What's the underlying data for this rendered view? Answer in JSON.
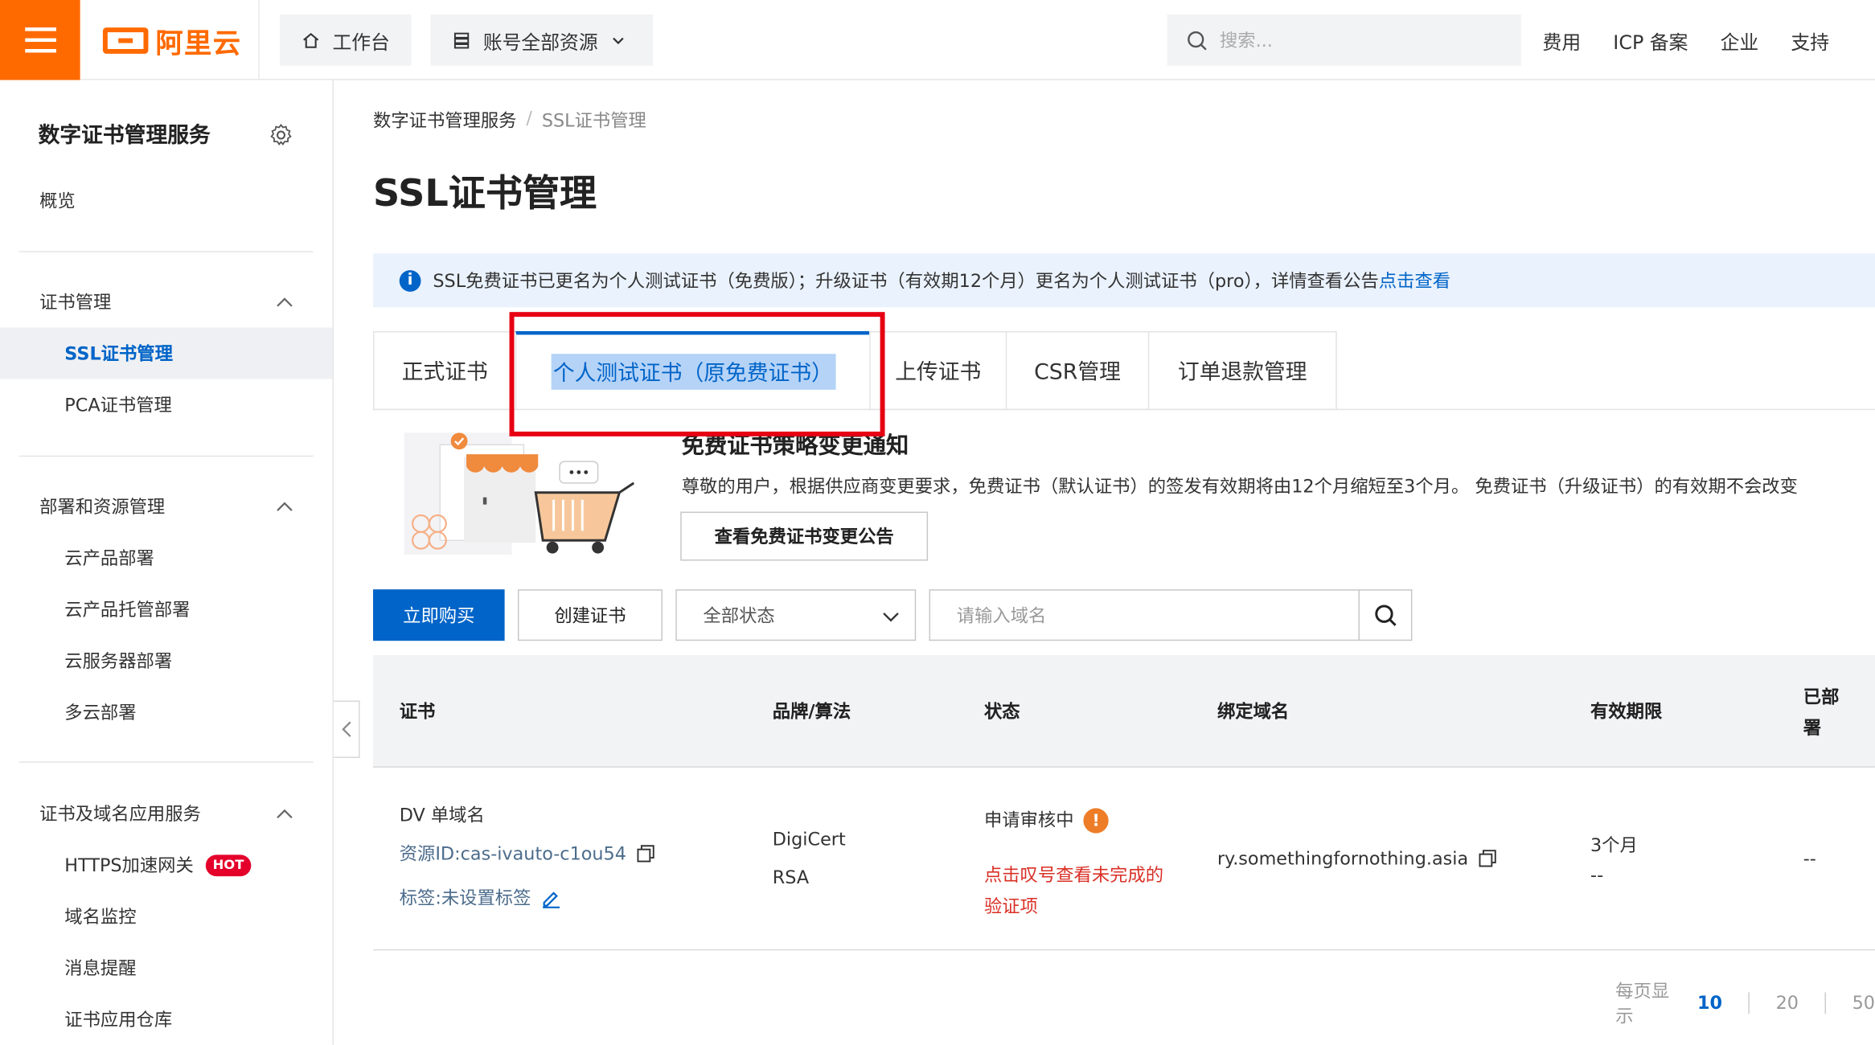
{
  "header": {
    "logo_text": "阿里云",
    "workbench_label": "工作台",
    "resources_label": "账号全部资源",
    "search_placeholder": "搜索...",
    "links": [
      "费用",
      "ICP 备案",
      "企业",
      "支持"
    ]
  },
  "sidebar": {
    "title": "数字证书管理服务",
    "overview": "概览",
    "groups": [
      {
        "label": "证书管理",
        "items": [
          "SSL证书管理",
          "PCA证书管理"
        ]
      },
      {
        "label": "部署和资源管理",
        "items": [
          "云产品部署",
          "云产品托管部署",
          "云服务器部署",
          "多云部署"
        ]
      },
      {
        "label": "证书及域名应用服务",
        "items": [
          "HTTPS加速网关",
          "域名监控",
          "消息提醒",
          "证书应用仓库"
        ]
      }
    ],
    "hot_badge": "HOT"
  },
  "breadcrumb": {
    "root": "数字证书管理服务",
    "sep": "/",
    "current": "SSL证书管理"
  },
  "page_title": "SSL证书管理",
  "notice": {
    "text": "SSL免费证书已更名为个人测试证书（免费版）；升级证书（有效期12个月）更名为个人测试证书（pro），详情查看公告",
    "link": "点击查看"
  },
  "tabs": [
    "正式证书",
    "个人测试证书（原免费证书）",
    "上传证书",
    "CSR管理",
    "订单退款管理"
  ],
  "promo": {
    "title": "免费证书策略变更通知",
    "text": "尊敬的用户，根据供应商变更要求，免费证书（默认证书）的签发有效期将由12个月缩短至3个月。 免费证书（升级证书）的有效期不会改变",
    "button": "查看免费证书变更公告"
  },
  "toolbar": {
    "buy": "立即购买",
    "create": "创建证书",
    "status_select": "全部状态",
    "domain_placeholder": "请输入域名"
  },
  "table": {
    "headers": [
      "证书",
      "品牌/算法",
      "状态",
      "绑定域名",
      "有效期限",
      "已部署"
    ],
    "rows": [
      {
        "type": "DV 单域名",
        "resource_id": "资源ID:cas-ivauto-c1ou54",
        "tag": "标签:未设置标签",
        "brand": "DigiCert",
        "algo": "RSA",
        "status": "申请审核中",
        "status_hint": "点击叹号查看未完成的验证项",
        "domain": "ry.somethingfornothing.asia",
        "validity": "3个月",
        "validity_sub": "--",
        "deployed": "--"
      }
    ]
  },
  "pager": {
    "label": "每页显示",
    "sizes": [
      "10",
      "20",
      "50"
    ]
  },
  "colors": {
    "brand": "#ff6a00",
    "primary": "#0064c8",
    "highlight": "#e60012",
    "warning": "#ed7d27"
  }
}
